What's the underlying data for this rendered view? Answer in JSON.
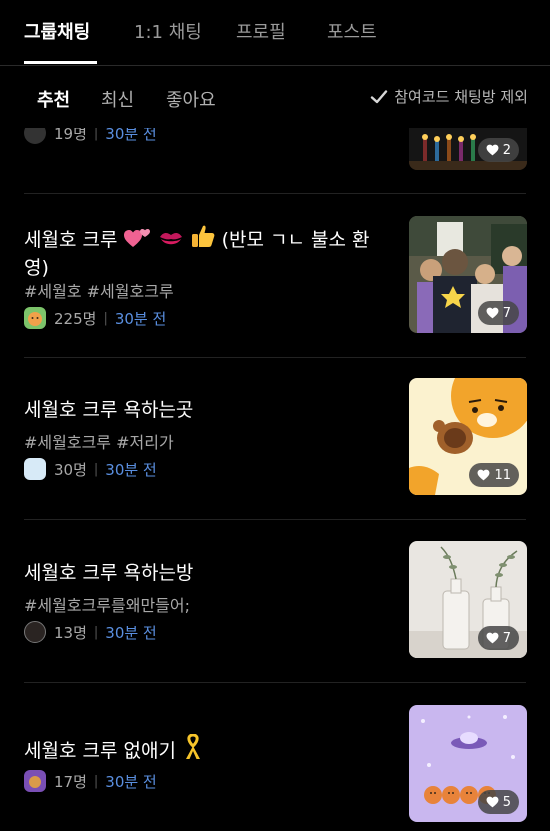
{
  "top_tabs": [
    "그룹채팅",
    "1:1 채팅",
    "프로필",
    "포스트"
  ],
  "filters": {
    "recommend": "추천",
    "latest": "최신",
    "likes": "좋아요",
    "exclude_label": "참여코드 채팅방 제외"
  },
  "items": [
    {
      "title": "",
      "tags": "",
      "members": "19명",
      "time": "30분 전",
      "likes": "2"
    },
    {
      "title": "세월호 크루",
      "title_suffix": "(반모 ㄱㄴ 불소 환영)",
      "tags": "#세월호 #세월호크루",
      "members": "225명",
      "time": "30분 전",
      "likes": "7"
    },
    {
      "title": "세월호 크루 욕하는곳",
      "tags": "#세월호크루 #저리가",
      "members": "30명",
      "time": "30분 전",
      "likes": "11"
    },
    {
      "title": "세월호 크루 욕하는방",
      "tags": "#세월호크루를왜만들어;",
      "members": "13명",
      "time": "30분 전",
      "likes": "7"
    },
    {
      "title": "세월호 크루 없애기",
      "tags": "",
      "members": "17명",
      "time": "30분 전",
      "likes": "5"
    }
  ],
  "colors": {
    "background": "#000000",
    "time_blue": "#5a8fe0",
    "muted": "#a8a8a8"
  },
  "icons": [
    "checkmark-icon",
    "heart-icon",
    "two-hearts-emoji",
    "kiss-mark-emoji",
    "thumbs-up-emoji",
    "yellow-ribbon-emoji"
  ]
}
